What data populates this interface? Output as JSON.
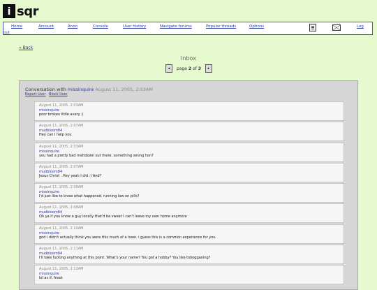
{
  "logo": {
    "mark": "i",
    "text": "sqr"
  },
  "nav": {
    "items": [
      {
        "label": "Home"
      },
      {
        "label": "Account"
      },
      {
        "label": "Anon"
      },
      {
        "label": "Console"
      },
      {
        "label": "User history"
      },
      {
        "label": "Navigate forums"
      },
      {
        "label": "Popular threads"
      },
      {
        "label": "Options"
      }
    ],
    "log_label": "Log",
    "out_label": "out",
    "icons": [
      "notes-icon",
      "mail-icon"
    ]
  },
  "back_label": "« Back",
  "inbox_title": "Inbox",
  "pager": {
    "prefix": "page",
    "current": "2",
    "of": "of",
    "total": "3",
    "prev": "◂",
    "next": "▸"
  },
  "conversation": {
    "heading": "Conversation with",
    "user": "missinquire",
    "date": "August 11, 2005, 2:03AM",
    "actions": [
      "Report User",
      "Block User"
    ]
  },
  "messages": [
    {
      "date": "August 11, 2005, 2:03AM",
      "user": "missinquire",
      "text": "poor broken little avery :("
    },
    {
      "date": "August 11, 2005, 2:07AM",
      "user": "mudbloom84",
      "text": "Hey can I help you"
    },
    {
      "date": "August 11, 2005, 2:03AM",
      "user": "missinquire",
      "text": "you had a pretty bad meltdown out there. something wrong hon?"
    },
    {
      "date": "August 11, 2005, 2:07AM",
      "user": "mudbloom84",
      "text": "Jesus Christ . Hey yeah I did :) And?"
    },
    {
      "date": "August 11, 2005, 2:08AM",
      "user": "missinquire",
      "text": "I'd just like to know what happened. running low on pills?"
    },
    {
      "date": "August 11, 2005, 2:08AM",
      "user": "mudbloom84",
      "text": "Oh ya if you know a guy locally that'd be sweet I can't leave my own home anymore"
    },
    {
      "date": "August 11, 2005, 2:10AM",
      "user": "missinquire",
      "text": "god i didn't actually think you were this much of a loser. i guess this is a common experience for you"
    },
    {
      "date": "August 11, 2005, 2:11AM",
      "user": "mudbloom84",
      "text": "I'll take fucking anything at this point. What's your name? You got a hobby? You like tobogganing?"
    },
    {
      "date": "August 11, 2005, 2:12AM",
      "user": "missinquire",
      "text": "lol as if, freak"
    }
  ]
}
